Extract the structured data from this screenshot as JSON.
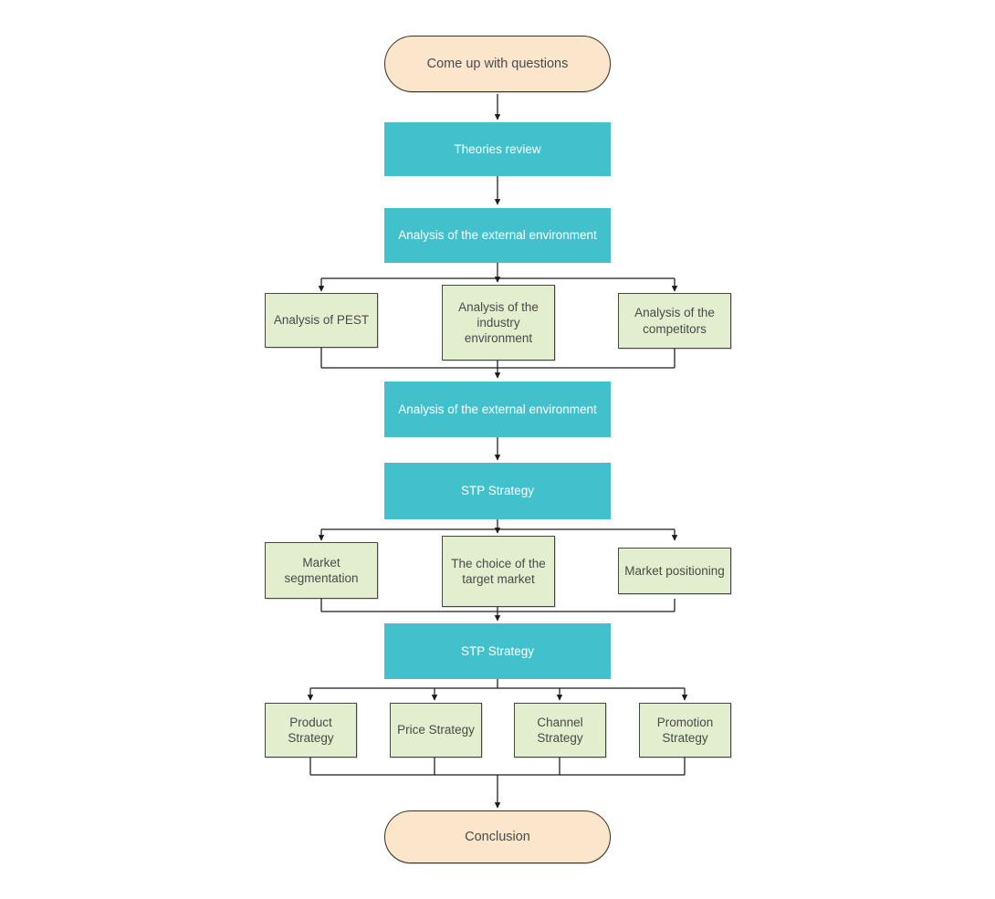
{
  "diagram": {
    "title": "Research methodology flowchart",
    "colors": {
      "terminal_fill": "#FCE6CB",
      "terminal_border": "#3b3326",
      "band_fill": "#42C0CB",
      "band_text": "#FFFFFF",
      "sub_fill": "#E2EECD",
      "sub_border": "#444840",
      "text": "#4a4a4a",
      "edge": "#1a1a1a",
      "background": "#FFFFFF"
    },
    "nodes": {
      "start": {
        "label": "Come up with questions",
        "type": "terminal"
      },
      "theories_review": {
        "label": "Theories review",
        "type": "band"
      },
      "external_env_1": {
        "label": "Analysis of the external environment",
        "type": "band"
      },
      "pest": {
        "label": "Analysis of PEST",
        "type": "sub"
      },
      "industry": {
        "label": "Analysis of the\nindustry\nenvironment",
        "type": "sub"
      },
      "competitors": {
        "label": "Analysis of the\ncompetitors",
        "type": "sub"
      },
      "external_env_2": {
        "label": "Analysis of the external environment",
        "type": "band"
      },
      "stp_1": {
        "label": "STP Strategy",
        "type": "band"
      },
      "segmentation": {
        "label": "Market\nsegmentation",
        "type": "sub"
      },
      "target_market": {
        "label": "The choice of the\ntarget market",
        "type": "sub"
      },
      "positioning": {
        "label": "Market positioning",
        "type": "sub"
      },
      "stp_2": {
        "label": "STP Strategy",
        "type": "band"
      },
      "product": {
        "label": "Product\nStrategy",
        "type": "sub"
      },
      "price": {
        "label": "Price Strategy",
        "type": "sub"
      },
      "channel": {
        "label": "Channel\nStrategy",
        "type": "sub"
      },
      "promotion": {
        "label": "Promotion\nStrategy",
        "type": "sub"
      },
      "conclusion": {
        "label": "Conclusion",
        "type": "terminal"
      }
    }
  }
}
